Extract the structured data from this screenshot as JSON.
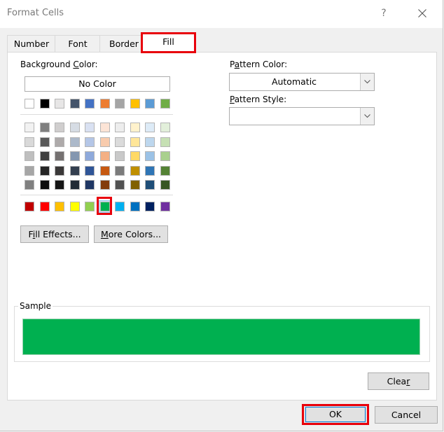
{
  "window": {
    "title": "Format Cells",
    "help_label": "?",
    "close_label": "✕"
  },
  "tabs": [
    {
      "label": "Number",
      "active": false
    },
    {
      "label": "Font",
      "active": false
    },
    {
      "label": "Border",
      "active": false
    },
    {
      "label": "Fill",
      "active": true
    }
  ],
  "background": {
    "label_pre": "Background ",
    "label_u": "C",
    "label_post": "olor:",
    "no_color_label": "No Color",
    "theme_row": [
      "#ffffff",
      "#000000",
      "#e7e6e6",
      "#44546a",
      "#4472c4",
      "#ed7d31",
      "#a5a5a5",
      "#ffc000",
      "#5b9bd5",
      "#70ad47"
    ],
    "tint_rows": [
      [
        "#f2f2f2",
        "#7f7f7f",
        "#d0cece",
        "#d6dce4",
        "#d9e1f2",
        "#fce4d6",
        "#ededed",
        "#fff2cc",
        "#ddebf7",
        "#e2efda"
      ],
      [
        "#d9d9d9",
        "#595959",
        "#aeaaaa",
        "#acb9ca",
        "#b4c6e7",
        "#f8cbad",
        "#dbdbdb",
        "#ffe699",
        "#bdd7ee",
        "#c6e0b4"
      ],
      [
        "#bfbfbf",
        "#404040",
        "#757171",
        "#8497b0",
        "#8ea9db",
        "#f4b084",
        "#c9c9c9",
        "#ffd966",
        "#9bc2e6",
        "#a9d08e"
      ],
      [
        "#a6a6a6",
        "#262626",
        "#3a3838",
        "#333f4f",
        "#2f5597",
        "#c65911",
        "#7b7b7b",
        "#bf8f00",
        "#2f75b5",
        "#548235"
      ],
      [
        "#808080",
        "#0d0d0d",
        "#161616",
        "#222b35",
        "#203764",
        "#833c0c",
        "#525252",
        "#806000",
        "#1f4e78",
        "#375623"
      ]
    ],
    "standard_row": [
      "#c00000",
      "#ff0000",
      "#ffc000",
      "#ffff00",
      "#92d050",
      "#00b050",
      "#00b0f0",
      "#0070c0",
      "#002060",
      "#7030a0"
    ],
    "selected_standard_index": 5
  },
  "buttons": {
    "fill_effects_pre": "F",
    "fill_effects_u": "i",
    "fill_effects_post": "ll Effects...",
    "more_colors_u": "M",
    "more_colors_post": "ore Colors...",
    "clear_pre": "Clea",
    "clear_u": "r",
    "ok": "OK",
    "cancel": "Cancel"
  },
  "pattern": {
    "color_label_pre": "P",
    "color_label_u": "a",
    "color_label_post": "ttern Color:",
    "color_value": "Automatic",
    "style_label_u": "P",
    "style_label_post": "attern Style:",
    "style_value": ""
  },
  "sample": {
    "label": "Sample",
    "color": "#00b050"
  }
}
